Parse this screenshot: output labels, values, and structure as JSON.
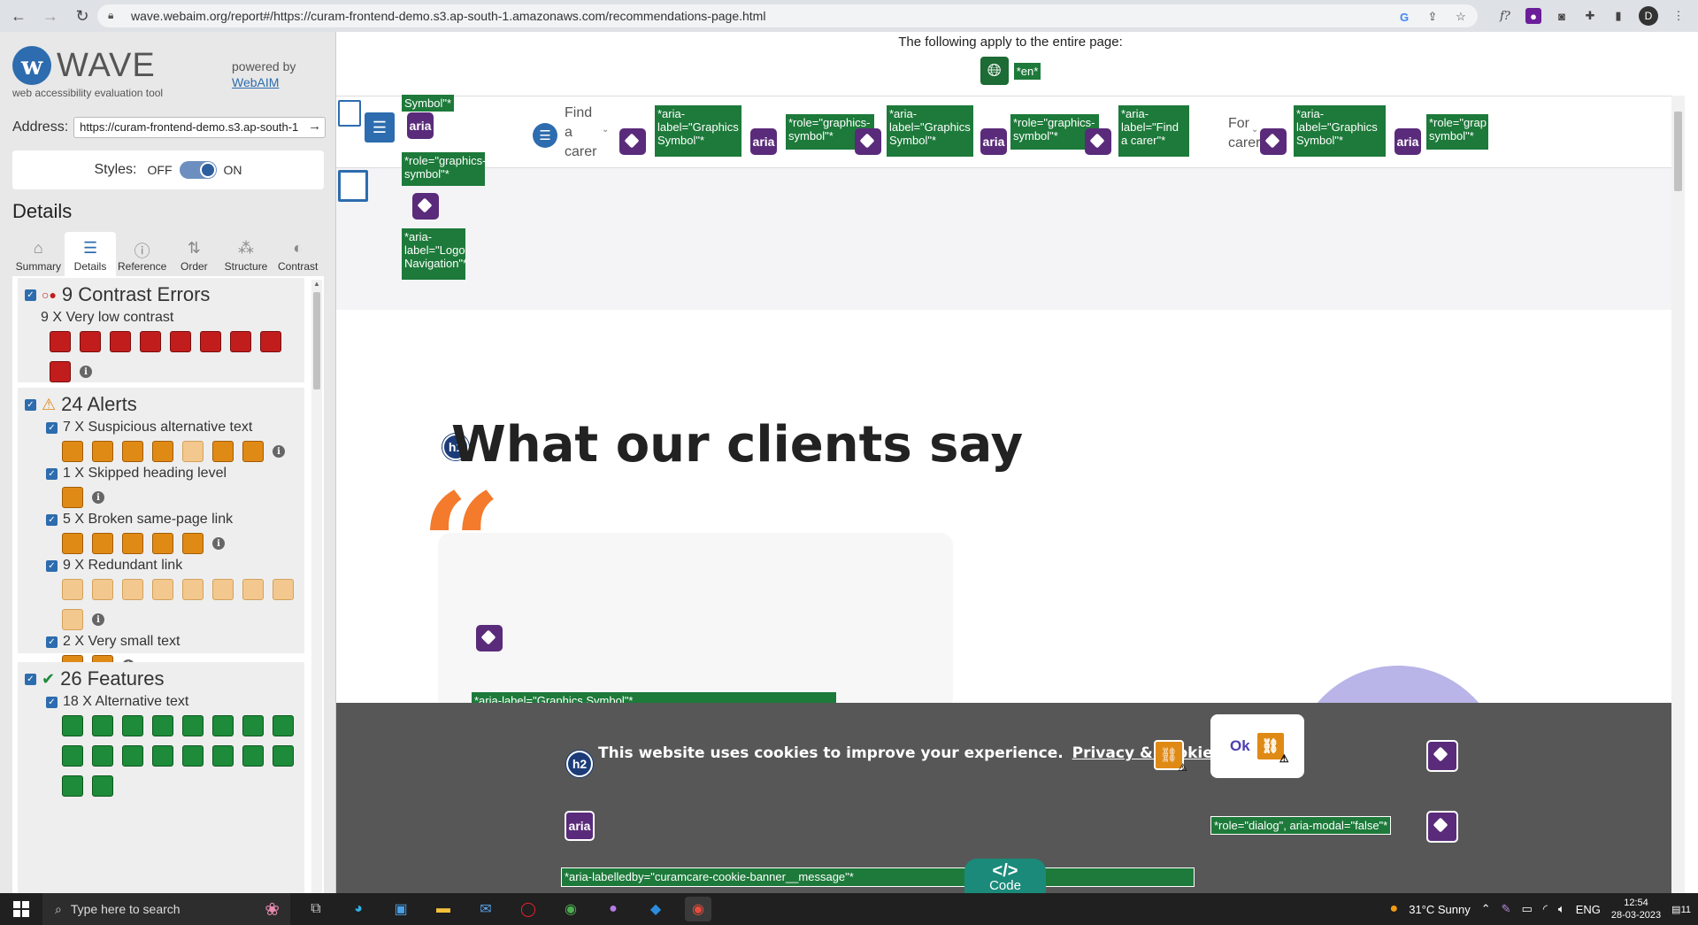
{
  "browser": {
    "url": "wave.webaim.org/report#/https://curam-frontend-demo.s3.ap-south-1.amazonaws.com/recommendations-page.html",
    "profile_initial": "D"
  },
  "wave": {
    "logo_text": "WAVE",
    "subtitle": "web accessibility evaluation tool",
    "powered_by": "powered by",
    "webaim_link": "WebAIM",
    "address_label": "Address:",
    "address_value": "https://curam-frontend-demo.s3.ap-south-1",
    "styles_label": "Styles:",
    "styles_off": "OFF",
    "styles_on": "ON",
    "details_title": "Details",
    "tabs": [
      {
        "label": "Summary",
        "icon": "home-icon"
      },
      {
        "label": "Details",
        "icon": "list-icon"
      },
      {
        "label": "Reference",
        "icon": "info-icon"
      },
      {
        "label": "Order",
        "icon": "order-icon"
      },
      {
        "label": "Structure",
        "icon": "structure-icon"
      },
      {
        "label": "Contrast",
        "icon": "contrast-icon"
      }
    ],
    "groups": {
      "contrast": {
        "title": "9 Contrast Errors",
        "categories": [
          {
            "label": "9 X Very low contrast",
            "count": 9
          }
        ]
      },
      "alerts": {
        "title": "24 Alerts",
        "categories": [
          {
            "label": "7 X Suspicious alternative text",
            "count": 7
          },
          {
            "label": "1 X Skipped heading level",
            "count": 1
          },
          {
            "label": "5 X Broken same-page link",
            "count": 5
          },
          {
            "label": "9 X Redundant link",
            "count": 9
          },
          {
            "label": "2 X Very small text",
            "count": 2
          }
        ]
      },
      "features": {
        "title": "26 Features",
        "categories": [
          {
            "label": "18 X Alternative text",
            "count": 18
          }
        ]
      }
    }
  },
  "page": {
    "applies_text": "The following apply to the entire page:",
    "lang_label": "*en*",
    "nav": {
      "symbol_top": "Symbol\"*",
      "role_graphics_symbol": "*role=\"graphics-symbol\"*",
      "aria_logo_nav": "*aria-label=\"Logo Navigation\"*",
      "find_a_carer": "Find a carer",
      "aria_graphics_symbol": "*aria-label=\"Graphics Symbol\"*",
      "role_graphics_symbol_short": "*role=\"graphics-symbol\"*",
      "aria_find_carer": "*aria-label=\"Find a carer\"*",
      "for_carers": "For carers",
      "role_grap": "*role=\"grap symbol\"*",
      "aria_text": "aria"
    },
    "heading_badge": "h1",
    "heading": "What our clients say",
    "card_label": "*aria-label=\"Graphics Symbol\"*",
    "cookie": {
      "badge": "h2",
      "message": "This website uses cookies to improve your experience.",
      "policy_link": "Privacy & cookie policy",
      "ok": "Ok",
      "role_dialog": "*role=\"dialog\", aria-modal=\"false\"*",
      "labelledby": "*aria-labelledby=\"curamcare-cookie-banner__message\"*",
      "aria_text": "aria"
    },
    "code_tab": "Code",
    "code_symbol": "</>"
  },
  "taskbar": {
    "search_placeholder": "Type here to search",
    "weather": "31°C  Sunny",
    "lang": "ENG",
    "time": "12:54",
    "date": "28-03-2023",
    "notif_count": "11"
  }
}
